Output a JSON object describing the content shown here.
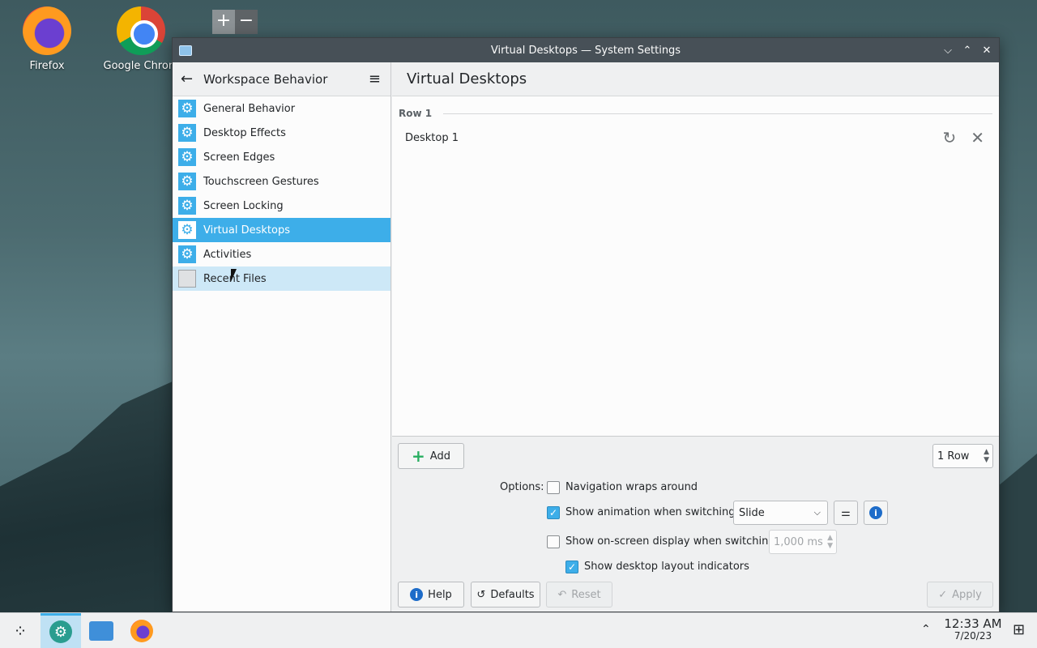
{
  "desktop": {
    "icons": [
      {
        "label": "Firefox",
        "icon": "firefox-icon"
      },
      {
        "label": "Google Chrom",
        "icon": "chrome-icon"
      }
    ],
    "zoom_widget": {
      "plus": "+",
      "minus": "−"
    }
  },
  "window": {
    "title": "Virtual Desktops — System Settings",
    "controls": {
      "minimize": "⌵",
      "maximize": "⌃",
      "close": "✕"
    }
  },
  "sidebar": {
    "title": "Workspace Behavior",
    "back_icon": "←",
    "menu_icon": "≡",
    "items": [
      {
        "label": "General Behavior",
        "icon": "gear-icon"
      },
      {
        "label": "Desktop Effects",
        "icon": "gear-icon"
      },
      {
        "label": "Screen Edges",
        "icon": "gear-icon"
      },
      {
        "label": "Touchscreen Gestures",
        "icon": "gear-icon"
      },
      {
        "label": "Screen Locking",
        "icon": "gear-icon"
      },
      {
        "label": "Virtual Desktops",
        "icon": "gear-icon",
        "selected": true
      },
      {
        "label": "Activities",
        "icon": "gear-icon"
      },
      {
        "label": "Recent Files",
        "icon": "recent-files-icon",
        "hovered": true
      }
    ]
  },
  "main": {
    "title": "Virtual Desktops",
    "row_heading": "Row 1",
    "desktops": [
      {
        "name": "Desktop 1"
      }
    ],
    "add_label": "Add",
    "rows_value": "1 Row",
    "options_label": "Options:",
    "options": {
      "wrap": {
        "label": "Navigation wraps around",
        "checked": false
      },
      "animation": {
        "label": "Show animation when switching:",
        "checked": true,
        "value": "Slide"
      },
      "osd": {
        "label": "Show on-screen display when switching:",
        "checked": false,
        "duration": "1,000 ms"
      },
      "layout_indicators": {
        "label": "Show desktop layout indicators",
        "checked": true
      }
    },
    "buttons": {
      "help": "Help",
      "defaults": "Defaults",
      "reset": "Reset",
      "apply": "Apply"
    }
  },
  "taskbar": {
    "time": "12:33 AM",
    "date": "7/20/23"
  },
  "colors": {
    "accent": "#3daee9",
    "titlebar": "#475057",
    "window_bg": "#eff0f1"
  }
}
